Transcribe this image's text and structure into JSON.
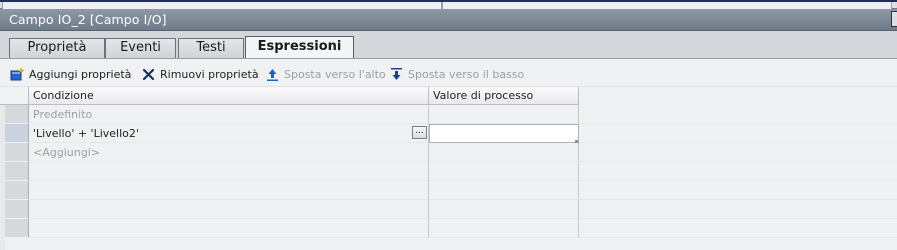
{
  "panel": {
    "title": "Campo IO_2 [Campo I/O]"
  },
  "tabs": [
    {
      "label": "Proprietà",
      "active": false
    },
    {
      "label": "Eventi",
      "active": false
    },
    {
      "label": "Testi",
      "active": false
    },
    {
      "label": "Espressioni",
      "active": true
    }
  ],
  "toolbar": {
    "add_label": "Aggiungi proprietà",
    "add_icon": "add-property-icon",
    "remove_label": "Rimuovi proprietà",
    "remove_icon": "remove-x-icon",
    "move_up_label": "Sposta verso l'alto",
    "move_up_icon": "arrow-up-icon",
    "move_down_label": "Sposta verso il basso",
    "move_down_icon": "arrow-down-icon"
  },
  "table": {
    "columns": [
      "Condizione",
      "Valore di processo"
    ],
    "rows": [
      {
        "condition": "Predefinito",
        "value": "",
        "muted": true
      },
      {
        "condition": "'Livello' + 'Livello2'",
        "value": "",
        "muted": false,
        "editing": true
      },
      {
        "condition": "<Aggiungi>",
        "value": "",
        "muted": true
      },
      {
        "condition": "",
        "value": ""
      },
      {
        "condition": "",
        "value": ""
      },
      {
        "condition": "",
        "value": ""
      },
      {
        "condition": "",
        "value": ""
      }
    ],
    "browse_button": "..."
  },
  "colors": {
    "title_bar": "#7d8796",
    "accent_icon": "#1f5fbf"
  }
}
